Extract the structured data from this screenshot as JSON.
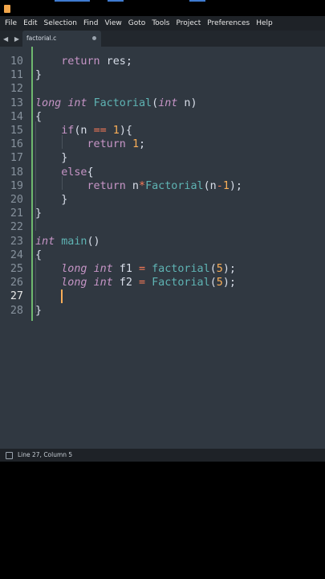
{
  "menu": [
    "File",
    "Edit",
    "Selection",
    "Find",
    "View",
    "Goto",
    "Tools",
    "Project",
    "Preferences",
    "Help"
  ],
  "tab": {
    "filename": "factorial.c"
  },
  "editor": {
    "lines": [
      {
        "num": "10",
        "segments": [
          [
            "    ",
            ""
          ],
          [
            "return",
            "kw"
          ],
          [
            " res;",
            ""
          ]
        ]
      },
      {
        "num": "11",
        "segments": [
          [
            "}",
            ""
          ]
        ]
      },
      {
        "num": "12",
        "segments": []
      },
      {
        "num": "13",
        "segments": [
          [
            "long",
            "kw-type"
          ],
          [
            " ",
            ""
          ],
          [
            "int",
            "kw-type"
          ],
          [
            " ",
            ""
          ],
          [
            "Factorial",
            "fn"
          ],
          [
            "(",
            ""
          ],
          [
            "int",
            "kw-type"
          ],
          [
            " n)",
            ""
          ]
        ]
      },
      {
        "num": "14",
        "segments": [
          [
            "{",
            ""
          ]
        ]
      },
      {
        "num": "15",
        "segments": [
          [
            "    ",
            ""
          ],
          [
            "if",
            "kw"
          ],
          [
            "(n ",
            ""
          ],
          [
            "==",
            "op"
          ],
          [
            " ",
            ""
          ],
          [
            "1",
            "num"
          ],
          [
            "){",
            ""
          ]
        ]
      },
      {
        "num": "16",
        "segments": [
          [
            "        ",
            ""
          ],
          [
            "return",
            "kw"
          ],
          [
            " ",
            ""
          ],
          [
            "1",
            "num"
          ],
          [
            ";",
            ""
          ]
        ]
      },
      {
        "num": "17",
        "segments": [
          [
            "    }",
            ""
          ]
        ]
      },
      {
        "num": "18",
        "segments": [
          [
            "    ",
            ""
          ],
          [
            "else",
            "kw"
          ],
          [
            "{",
            ""
          ]
        ]
      },
      {
        "num": "19",
        "segments": [
          [
            "        ",
            ""
          ],
          [
            "return",
            "kw"
          ],
          [
            " n",
            ""
          ],
          [
            "*",
            "op"
          ],
          [
            "Factorial",
            "fn"
          ],
          [
            "(n",
            ""
          ],
          [
            "-",
            "op"
          ],
          [
            "1",
            "num"
          ],
          [
            ");",
            ""
          ]
        ]
      },
      {
        "num": "20",
        "segments": [
          [
            "    }",
            ""
          ]
        ]
      },
      {
        "num": "21",
        "segments": [
          [
            "}",
            ""
          ]
        ]
      },
      {
        "num": "22",
        "segments": []
      },
      {
        "num": "23",
        "segments": [
          [
            "int",
            "kw-type"
          ],
          [
            " ",
            ""
          ],
          [
            "main",
            "fn"
          ],
          [
            "()",
            ""
          ]
        ]
      },
      {
        "num": "24",
        "segments": [
          [
            "{",
            ""
          ]
        ]
      },
      {
        "num": "25",
        "segments": [
          [
            "    ",
            ""
          ],
          [
            "long",
            "kw-type"
          ],
          [
            " ",
            ""
          ],
          [
            "int",
            "kw-type"
          ],
          [
            " f1 ",
            ""
          ],
          [
            "=",
            "op"
          ],
          [
            " ",
            ""
          ],
          [
            "factorial",
            "fn"
          ],
          [
            "(",
            ""
          ],
          [
            "5",
            "num"
          ],
          [
            ");",
            ""
          ]
        ]
      },
      {
        "num": "26",
        "segments": [
          [
            "    ",
            ""
          ],
          [
            "long",
            "kw-type"
          ],
          [
            " ",
            ""
          ],
          [
            "int",
            "kw-type"
          ],
          [
            " f2 ",
            ""
          ],
          [
            "=",
            "op"
          ],
          [
            " ",
            ""
          ],
          [
            "Factorial",
            "fn"
          ],
          [
            "(",
            ""
          ],
          [
            "5",
            "num"
          ],
          [
            ");",
            ""
          ]
        ]
      },
      {
        "num": "27",
        "segments": [],
        "active": true
      },
      {
        "num": "28",
        "segments": [
          [
            "}",
            ""
          ]
        ]
      }
    ]
  },
  "status": {
    "text": "Line 27, Column 5"
  },
  "colors": {
    "background": "#303841",
    "cursor": "#f9ae58",
    "keyword": "#c695c6",
    "function": "#5fb4b4",
    "number": "#f9ae58",
    "operator": "#f97b58"
  }
}
